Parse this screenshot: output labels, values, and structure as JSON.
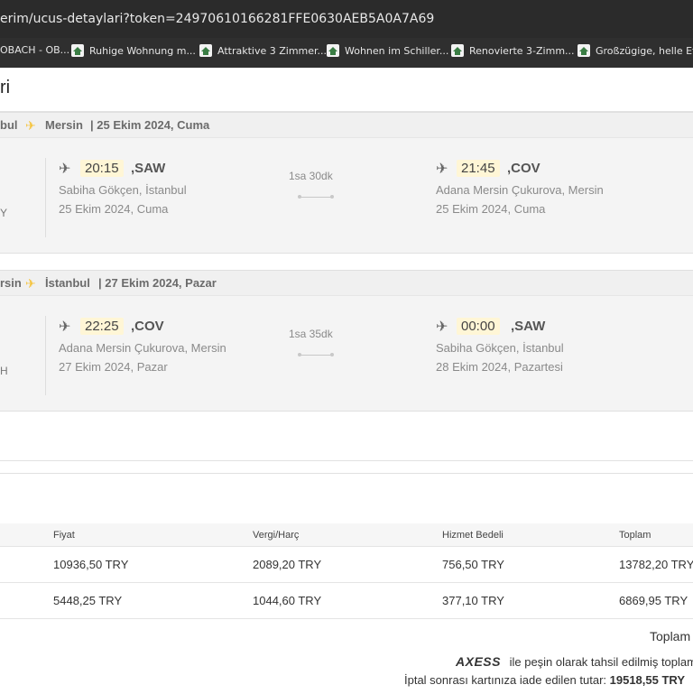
{
  "browser": {
    "url": "erim/ucus-detaylari?token=24970610166281FFE0630AEB5A0A7A69",
    "bookmarks": [
      {
        "label": "OBACH - OB..."
      },
      {
        "label": "Ruhige Wohnung m..."
      },
      {
        "label": "Attraktive 3 Zimmer..."
      },
      {
        "label": "Wohnen im Schiller..."
      },
      {
        "label": "Renovierte 3-Zimm..."
      },
      {
        "label": "Großzügige, helle Et..."
      }
    ]
  },
  "page": {
    "title_fragment": "ri"
  },
  "flights": [
    {
      "route_from": "bul",
      "route_to": "Mersin",
      "route_date": "| 25 Ekim 2024, Cuma",
      "left_fragment": "Y",
      "departure": {
        "time": "20:15",
        "code": ",SAW",
        "airport": "Sabiha Gökçen, İstanbul",
        "date": "25 Ekim 2024, Cuma"
      },
      "duration": "1sa 30dk",
      "arrival": {
        "time": "21:45",
        "code": ",COV",
        "airport": "Adana Mersin Çukurova, Mersin",
        "date": "25 Ekim 2024, Cuma"
      }
    },
    {
      "route_from": "rsin",
      "route_to": "İstanbul",
      "route_date": "| 27 Ekim 2024, Pazar",
      "left_fragment": "H",
      "departure": {
        "time": "22:25",
        "code": ",COV",
        "airport": "Adana Mersin Çukurova, Mersin",
        "date": "27 Ekim 2024, Pazar"
      },
      "duration": "1sa 35dk",
      "arrival": {
        "time": "00:00",
        "code": ",SAW",
        "airport": "Sabiha Gökçen, İstanbul",
        "date": "28 Ekim 2024, Pazartesi"
      }
    }
  ],
  "price_table": {
    "headers": [
      "Fiyat",
      "Vergi/Harç",
      "Hizmet Bedeli",
      "Toplam"
    ],
    "rows": [
      [
        "10936,50 TRY",
        "2089,20 TRY",
        "756,50 TRY",
        "13782,20 TRY"
      ],
      [
        "5448,25 TRY",
        "1044,60 TRY",
        "377,10 TRY",
        "6869,95 TRY"
      ]
    ]
  },
  "summary": {
    "total_label": "Toplam",
    "card_brand": "AXESS",
    "paid_text": "ile peşin olarak tahsil edilmiş toplam",
    "refund_label": "İptal sonrası kartınıza iade edilen tutar:",
    "refund_amount": "19518,55 TRY"
  },
  "colors": {
    "accent": "#f5c542",
    "time_bg": "#fff6d6",
    "dark_bar": "#2b2b2b"
  }
}
